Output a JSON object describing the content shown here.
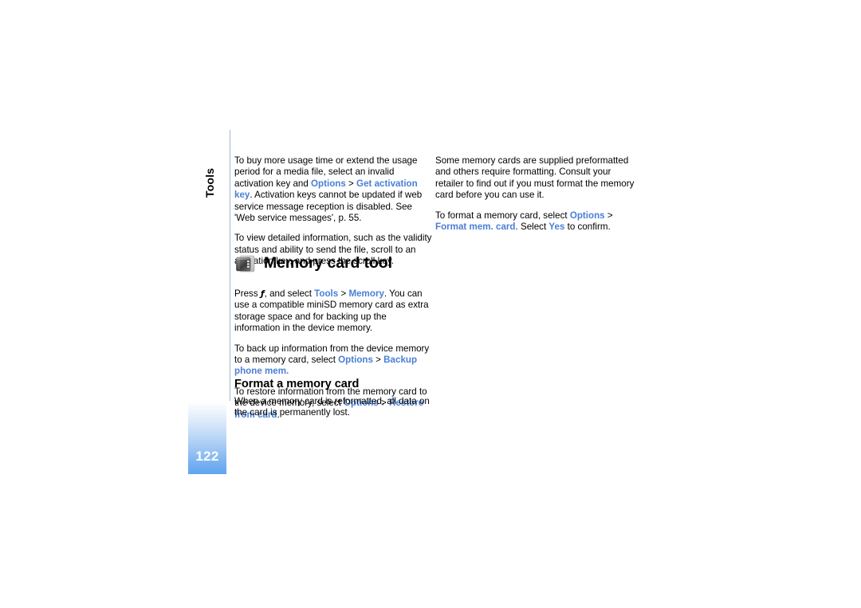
{
  "document": {
    "chapter_label": "Tools",
    "page_number": "122"
  },
  "colors": {
    "link": "#4a7fd6",
    "tab_gradient_end": "#5ea6ee",
    "rule": "#9fb8cf"
  },
  "left_column": {
    "paragraph_1": {
      "t1": "To buy more usage time or extend the usage period for a media file, select an invalid activation key and ",
      "link1": "Options",
      "t2": " > ",
      "link2": "Get activation key",
      "t3": ". Activation keys cannot be updated if web service message reception is disabled. See 'Web service messages', p. 55."
    },
    "paragraph_2": {
      "t1": "To view detailed information, such as the validity status and ability to send the file, scroll to an activation key, and press the scroll key."
    }
  },
  "right_column": {
    "paragraph_1": {
      "t1": "Some memory cards are supplied preformatted and others require formatting. Consult your retailer to find out if you must format the memory card before you can use it."
    },
    "paragraph_2": {
      "t1": "To format a memory card, select ",
      "link1": "Options",
      "t2": " > ",
      "link2": "Format mem. card",
      "t3": ". Select ",
      "link3": "Yes",
      "t4": " to confirm."
    }
  },
  "section": {
    "icon_name": "memory-card-icon",
    "title": "Memory card tool",
    "paragraph_1": {
      "t1": "Press ",
      "key": "ƒ",
      "t2": ", and select ",
      "link1": "Tools",
      "t3": " > ",
      "link2": "Memory",
      "t4": ". You can use a compatible miniSD memory card as extra storage space and for backing up the information in the device memory."
    },
    "paragraph_2": {
      "t1": "To back up information from the device memory to a memory card, select ",
      "link1": "Options",
      "t2": " > ",
      "link2": "Backup phone mem.",
      "t3": ""
    },
    "paragraph_3": {
      "t1": "To restore information from the memory card to the device memory, select ",
      "link1": "Options",
      "t2": " > ",
      "link2": "Restore from card",
      "t3": "."
    }
  },
  "subsection": {
    "title": "Format a memory card",
    "paragraph_1": {
      "t1": "When a memory card is reformatted, all data on the card is permanently lost."
    }
  }
}
